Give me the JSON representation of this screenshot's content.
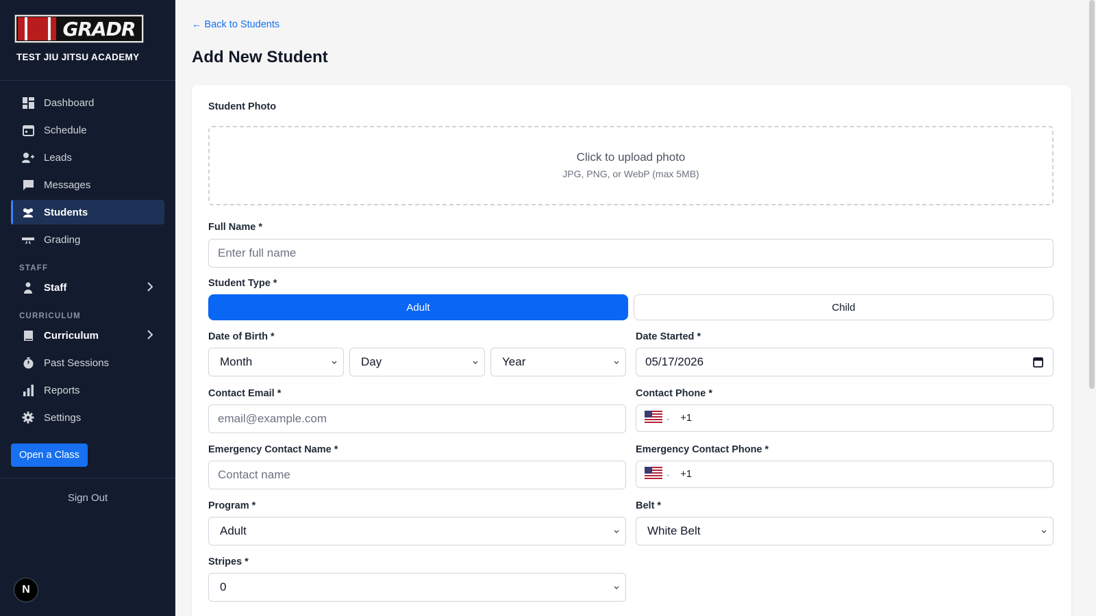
{
  "sidebar": {
    "logo_text": "GRADR",
    "academy_name": "TEST JIU JITSU ACADEMY",
    "nav_main": [
      {
        "label": "Dashboard",
        "icon": "dashboard-icon"
      },
      {
        "label": "Schedule",
        "icon": "calendar-icon"
      },
      {
        "label": "Leads",
        "icon": "add-user-icon"
      },
      {
        "label": "Messages",
        "icon": "chat-icon"
      },
      {
        "label": "Students",
        "icon": "students-icon",
        "active": true
      },
      {
        "label": "Grading",
        "icon": "belt-icon"
      }
    ],
    "staff_section": "STAFF",
    "staff_item": "Staff",
    "curriculum_section": "CURRICULUM",
    "curriculum_item": "Curriculum",
    "nav_bottom": [
      {
        "label": "Past Sessions",
        "icon": "timer-icon"
      },
      {
        "label": "Reports",
        "icon": "bar-chart-icon"
      },
      {
        "label": "Settings",
        "icon": "gear-icon"
      }
    ],
    "open_class_label": "Open a Class",
    "sign_out_label": "Sign Out",
    "badge_letter": "N"
  },
  "main": {
    "back_link": "← Back to Students",
    "title": "Add New Student"
  },
  "form": {
    "photo_label": "Student Photo",
    "upload_title": "Click to upload photo",
    "upload_hint": "JPG, PNG, or WebP (max 5MB)",
    "full_name_label": "Full Name *",
    "full_name_placeholder": "Enter full name",
    "student_type_label": "Student Type *",
    "type_options": [
      "Adult",
      "Child"
    ],
    "type_selected": "Adult",
    "dob_label": "Date of Birth *",
    "dob_month": "Month",
    "dob_day": "Day",
    "dob_year": "Year",
    "date_started_label": "Date Started *",
    "date_started_value": "05/17/2026",
    "email_label": "Contact Email *",
    "email_placeholder": "email@example.com",
    "phone_label": "Contact Phone *",
    "phone_prefix": "+1",
    "emergency_name_label": "Emergency Contact Name *",
    "emergency_name_placeholder": "Contact name",
    "emergency_phone_label": "Emergency Contact Phone *",
    "emergency_phone_prefix": "+1",
    "program_label": "Program *",
    "program_value": "Adult",
    "belt_label": "Belt *",
    "belt_value": "White Belt",
    "stripes_label": "Stripes *",
    "stripes_value": "0"
  },
  "colors": {
    "sidebar_bg": "#131c2e",
    "accent": "#0a66f5",
    "active_nav": "#1e3257"
  }
}
